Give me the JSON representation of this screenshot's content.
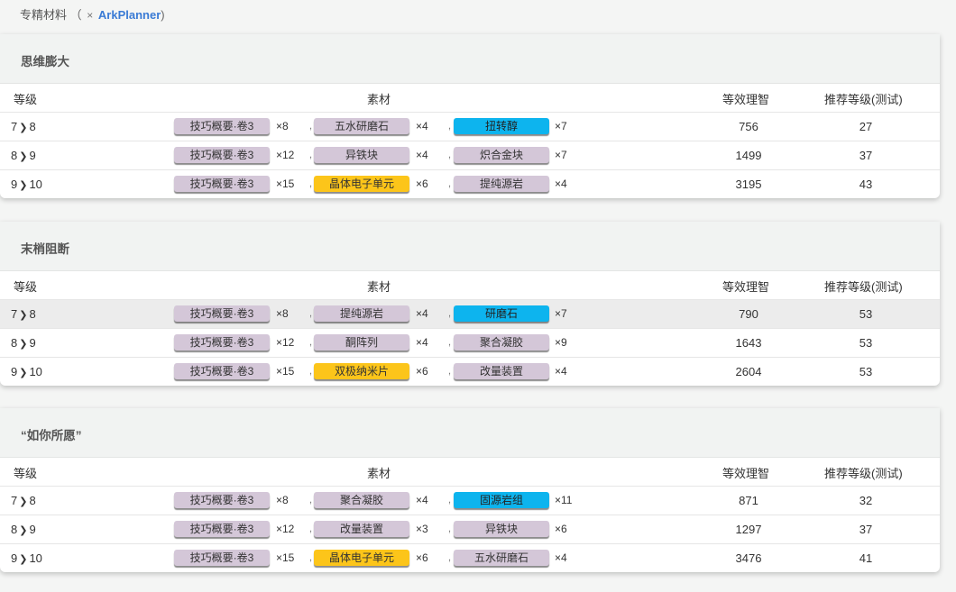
{
  "header": {
    "title": "专精材料",
    "paren_open": "（",
    "close_x": "×",
    "link": "ArkPlanner",
    "paren_close": ")"
  },
  "columns": {
    "level": "等级",
    "materials": "素材",
    "equiv": "等效理智",
    "recommend": "推荐等级(测试)"
  },
  "separator": ",",
  "arrow": "❯",
  "colors": {
    "default_pill": "#d4c7d8",
    "blue_pill": "#0db4ee",
    "yellow_pill": "#fcc51a"
  },
  "skills": [
    {
      "name": "思维膨大",
      "rows": [
        {
          "from": "7",
          "to": "8",
          "mats": [
            {
              "name": "技巧概要·卷3",
              "qty": "×8",
              "color": "default"
            },
            {
              "name": "五水研磨石",
              "qty": "×4",
              "color": "default"
            },
            {
              "name": "扭转醇",
              "qty": "×7",
              "color": "blue"
            }
          ],
          "equiv": "756",
          "rec": "27"
        },
        {
          "from": "8",
          "to": "9",
          "mats": [
            {
              "name": "技巧概要·卷3",
              "qty": "×12",
              "color": "default"
            },
            {
              "name": "异铁块",
              "qty": "×4",
              "color": "default"
            },
            {
              "name": "炽合金块",
              "qty": "×7",
              "color": "default"
            }
          ],
          "equiv": "1499",
          "rec": "37"
        },
        {
          "from": "9",
          "to": "10",
          "mats": [
            {
              "name": "技巧概要·卷3",
              "qty": "×15",
              "color": "default"
            },
            {
              "name": "晶体电子单元",
              "qty": "×6",
              "color": "yellow"
            },
            {
              "name": "提纯源岩",
              "qty": "×4",
              "color": "default"
            }
          ],
          "equiv": "3195",
          "rec": "43"
        }
      ]
    },
    {
      "name": "末梢阻断",
      "rows": [
        {
          "from": "7",
          "to": "8",
          "highlight": true,
          "mats": [
            {
              "name": "技巧概要·卷3",
              "qty": "×8",
              "color": "default"
            },
            {
              "name": "提纯源岩",
              "qty": "×4",
              "color": "default"
            },
            {
              "name": "研磨石",
              "qty": "×7",
              "color": "blue"
            }
          ],
          "equiv": "790",
          "rec": "53"
        },
        {
          "from": "8",
          "to": "9",
          "mats": [
            {
              "name": "技巧概要·卷3",
              "qty": "×12",
              "color": "default"
            },
            {
              "name": "酮阵列",
              "qty": "×4",
              "color": "default"
            },
            {
              "name": "聚合凝胶",
              "qty": "×9",
              "color": "default"
            }
          ],
          "equiv": "1643",
          "rec": "53"
        },
        {
          "from": "9",
          "to": "10",
          "mats": [
            {
              "name": "技巧概要·卷3",
              "qty": "×15",
              "color": "default"
            },
            {
              "name": "双极纳米片",
              "qty": "×6",
              "color": "yellow"
            },
            {
              "name": "改量装置",
              "qty": "×4",
              "color": "default"
            }
          ],
          "equiv": "2604",
          "rec": "53"
        }
      ]
    },
    {
      "name": "“如你所愿”",
      "rows": [
        {
          "from": "7",
          "to": "8",
          "mats": [
            {
              "name": "技巧概要·卷3",
              "qty": "×8",
              "color": "default"
            },
            {
              "name": "聚合凝胶",
              "qty": "×4",
              "color": "default"
            },
            {
              "name": "固源岩组",
              "qty": "×11",
              "color": "blue"
            }
          ],
          "equiv": "871",
          "rec": "32"
        },
        {
          "from": "8",
          "to": "9",
          "mats": [
            {
              "name": "技巧概要·卷3",
              "qty": "×12",
              "color": "default"
            },
            {
              "name": "改量装置",
              "qty": "×3",
              "color": "default"
            },
            {
              "name": "异铁块",
              "qty": "×6",
              "color": "default"
            }
          ],
          "equiv": "1297",
          "rec": "37"
        },
        {
          "from": "9",
          "to": "10",
          "mats": [
            {
              "name": "技巧概要·卷3",
              "qty": "×15",
              "color": "default"
            },
            {
              "name": "晶体电子单元",
              "qty": "×6",
              "color": "yellow"
            },
            {
              "name": "五水研磨石",
              "qty": "×4",
              "color": "default"
            }
          ],
          "equiv": "3476",
          "rec": "41"
        }
      ]
    }
  ]
}
